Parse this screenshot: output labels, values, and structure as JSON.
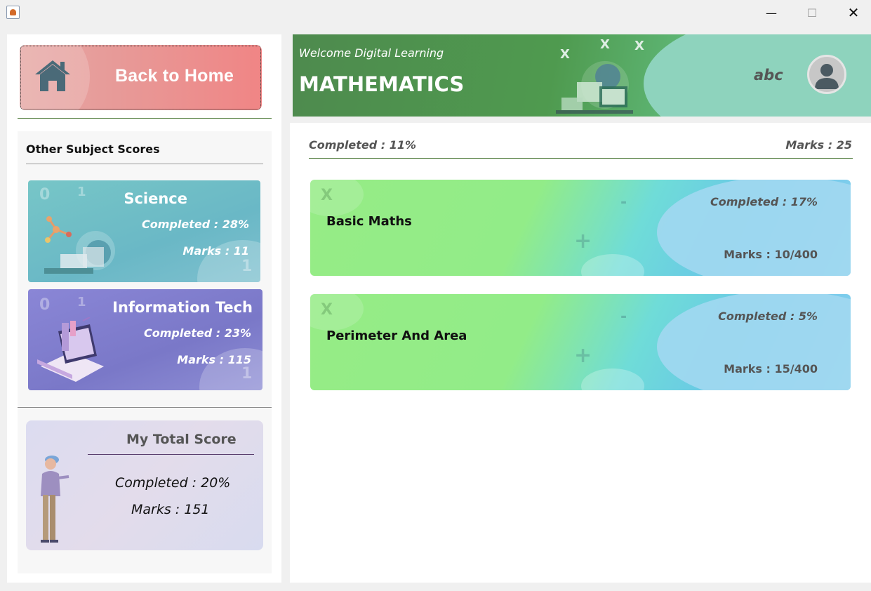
{
  "window": {
    "minimize_glyph": "—",
    "maximize_glyph": "☐",
    "close_glyph": "✕"
  },
  "sidebar": {
    "back_button_label": "Back to Home",
    "other_scores_title": "Other Subject Scores",
    "subjects": [
      {
        "name": "Science",
        "completed": "Completed : 28%",
        "marks": "Marks : 11",
        "color": "#6ab8c6"
      },
      {
        "name": "Information Tech",
        "completed": "Completed : 23%",
        "marks": "Marks : 115",
        "color": "#7a78c8"
      }
    ],
    "total": {
      "title": "My Total Score",
      "completed": "Completed : 20%",
      "marks": "Marks : 151"
    }
  },
  "header": {
    "welcome": "Welcome Digital Learning",
    "subject": "MATHEMATICS",
    "username": "abc"
  },
  "summary": {
    "completed": "Completed : 11%",
    "marks": "Marks : 25"
  },
  "topics": [
    {
      "name": "Basic Maths",
      "completed": "Completed : 17%",
      "marks": "Marks : 10/400"
    },
    {
      "name": "Perimeter And Area",
      "completed": "Completed : 5%",
      "marks": "Marks : 15/400"
    }
  ],
  "decor": {
    "x_glyph": "X",
    "minus_glyph": "-",
    "plus_glyph": "+",
    "digit_zero": "0",
    "digit_one": "1"
  },
  "colors": {
    "back_button": "#f08585",
    "header_green": "#4f9a4f",
    "header_mint": "#8ed3bd",
    "topic_green": "#96ec86",
    "topic_blue": "#68c4e9"
  }
}
